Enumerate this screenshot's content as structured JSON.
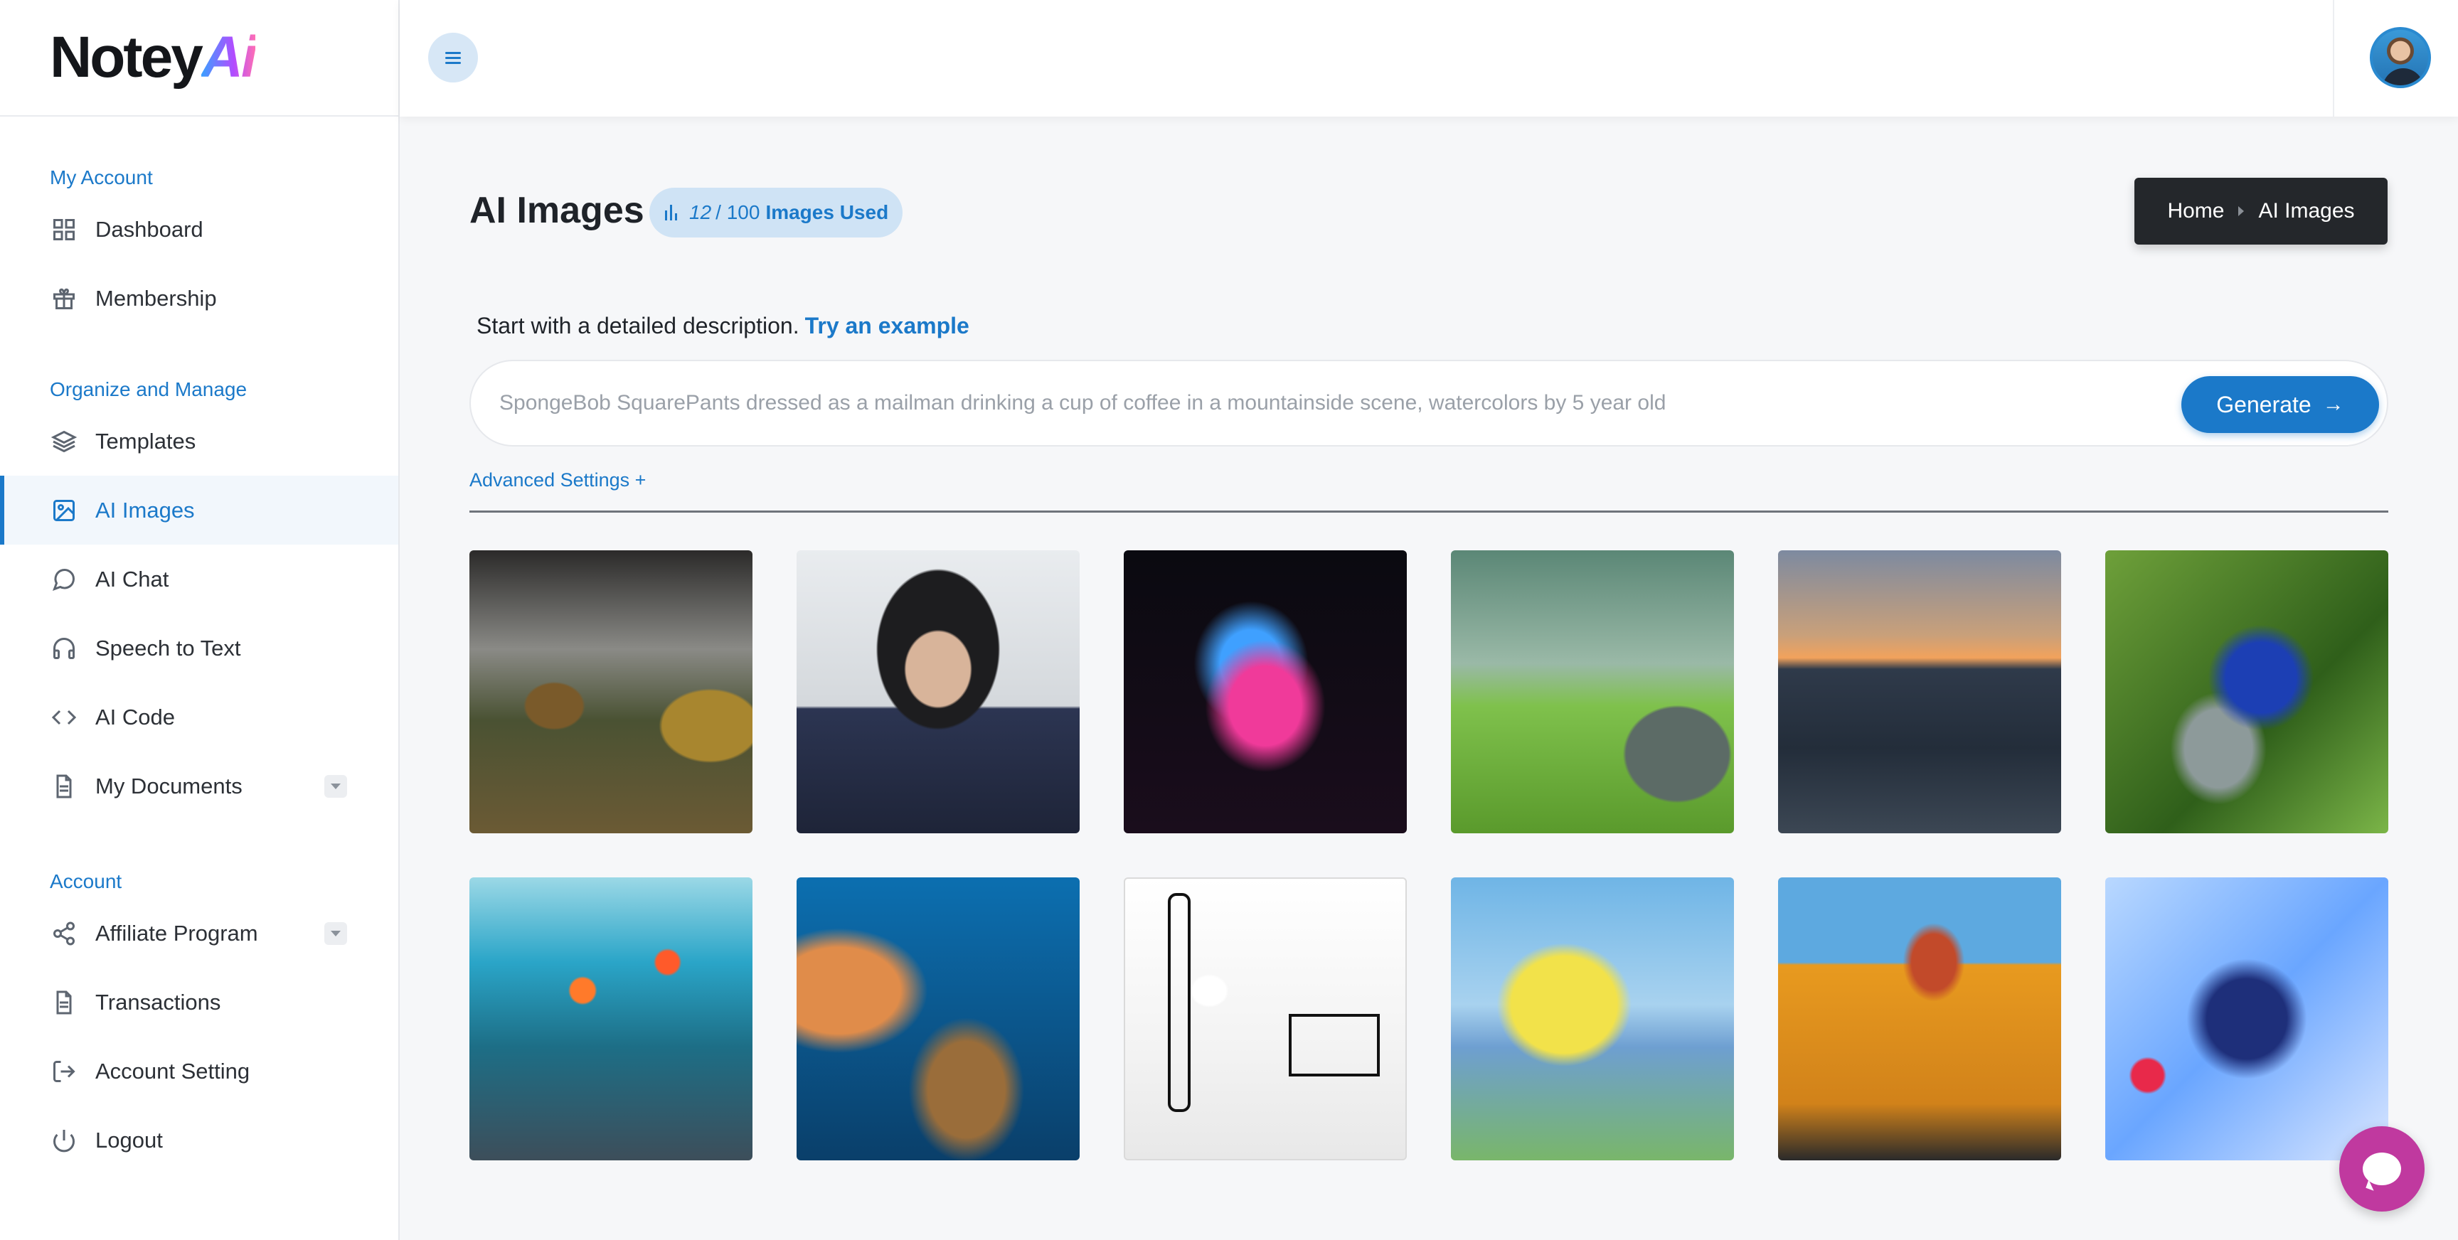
{
  "app": {
    "logo_text": "Notey",
    "logo_accent": "Ai"
  },
  "sidebar": {
    "sections": [
      {
        "title": "My Account",
        "items": [
          {
            "label": "Dashboard",
            "icon": "grid-icon"
          },
          {
            "label": "Membership",
            "icon": "gift-icon"
          }
        ]
      },
      {
        "title": "Organize and Manage",
        "items": [
          {
            "label": "Templates",
            "icon": "layers-icon"
          },
          {
            "label": "AI Images",
            "icon": "image-icon",
            "active": true
          },
          {
            "label": "AI Chat",
            "icon": "chat-bubble-icon"
          },
          {
            "label": "Speech to Text",
            "icon": "headphones-icon"
          },
          {
            "label": "AI Code",
            "icon": "code-icon"
          },
          {
            "label": "My Documents",
            "icon": "document-icon",
            "has_dropdown": true
          }
        ]
      },
      {
        "title": "Account",
        "items": [
          {
            "label": "Affiliate Program",
            "icon": "share-icon",
            "has_dropdown": true
          },
          {
            "label": "Transactions",
            "icon": "receipt-icon"
          },
          {
            "label": "Account Setting",
            "icon": "sign-out-arrow-icon"
          },
          {
            "label": "Logout",
            "icon": "power-icon"
          }
        ]
      }
    ]
  },
  "header": {
    "menu_icon": "hamburger-menu-icon",
    "avatar_icon": "user-avatar"
  },
  "page": {
    "title": "AI Images",
    "usage": {
      "used": "12",
      "total": "/ 100",
      "label": "Images Used",
      "icon": "bar-chart-icon"
    },
    "breadcrumb": [
      "Home",
      "AI Images"
    ]
  },
  "prompt": {
    "hint": "Start with a detailed description.",
    "example_link": "Try an example",
    "placeholder": "SpongeBob SquarePants dressed as a mailman drinking a cup of coffee in a mountainside scene, watercolors by 5 year old",
    "generate_label": "Generate",
    "advanced_label": "Advanced Settings +"
  },
  "gallery": {
    "images": [
      "surreal-landscape-image",
      "portrait-headdress-image",
      "glowing-treasure-chest-image",
      "turtle-teapot-lawn-image",
      "ocean-sunset-image",
      "peacock-image",
      "underwater-city-fish-image",
      "coral-reef-fish-image",
      "cactus-line-drawing-image",
      "spongebob-watercolor-image",
      "school-bus-cat-image",
      "anime-warrior-image"
    ]
  },
  "colors": {
    "accent": "#1b79c9",
    "chat_button": "#c0399f",
    "breadcrumb_bg": "#24272b"
  },
  "chat_widget": {
    "icon": "chat-widget-icon"
  }
}
